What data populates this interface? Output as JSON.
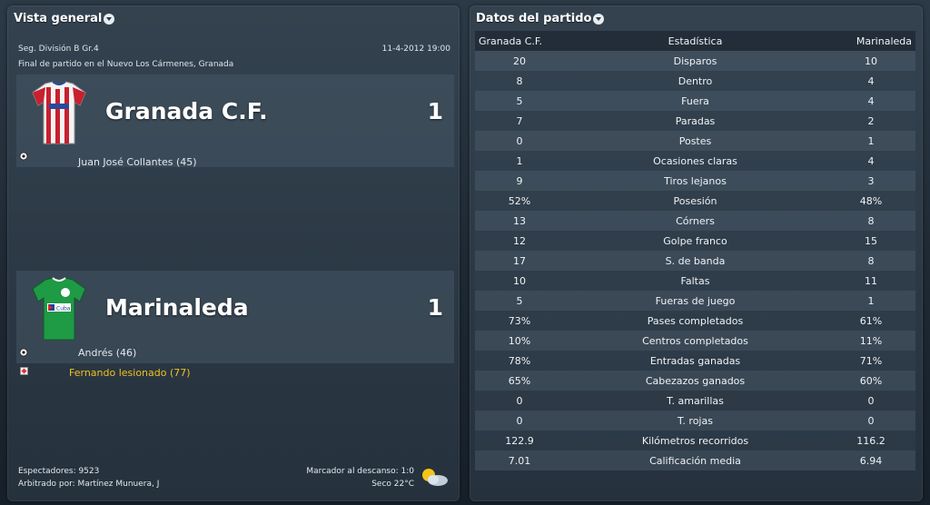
{
  "overview": {
    "title": "Vista general",
    "competition": "Seg. División B Gr.4",
    "datetime": "11-4-2012 19:00",
    "venue": "Final de partido en el Nuevo Los Cármenes, Granada",
    "home": {
      "name": "Granada C.F.",
      "score": "1",
      "goal_event": "Juan José Collantes (45)"
    },
    "away": {
      "name": "Marinaleda",
      "score": "1",
      "goal_event": "Andrés (46)",
      "injury_event": "Fernando lesionado (77)"
    },
    "attendance": "Espectadores: 9523",
    "referee": "Arbitrado por: Martínez Munuera, J",
    "halftime": "Marcador al descanso: 1:0",
    "weather": "Seco 22°C",
    "weather_icon": "sun-cloud-icon",
    "injury_color": "#f2c01e"
  },
  "match_stats": {
    "title": "Datos del partido",
    "headers": {
      "home": "Granada C.F.",
      "stat": "Estadística",
      "away": "Marinaleda"
    },
    "rows": [
      {
        "home": "20",
        "stat": "Disparos",
        "away": "10"
      },
      {
        "home": "8",
        "stat": "Dentro",
        "away": "4"
      },
      {
        "home": "5",
        "stat": "Fuera",
        "away": "4"
      },
      {
        "home": "7",
        "stat": "Paradas",
        "away": "2"
      },
      {
        "home": "0",
        "stat": "Postes",
        "away": "1"
      },
      {
        "home": "1",
        "stat": "Ocasiones claras",
        "away": "4"
      },
      {
        "home": "9",
        "stat": "Tiros lejanos",
        "away": "3"
      },
      {
        "home": "52%",
        "stat": "Posesión",
        "away": "48%"
      },
      {
        "home": "13",
        "stat": "Córners",
        "away": "8"
      },
      {
        "home": "12",
        "stat": "Golpe franco",
        "away": "15"
      },
      {
        "home": "17",
        "stat": "S. de banda",
        "away": "8"
      },
      {
        "home": "10",
        "stat": "Faltas",
        "away": "11"
      },
      {
        "home": "5",
        "stat": "Fueras de juego",
        "away": "1"
      },
      {
        "home": "73%",
        "stat": "Pases completados",
        "away": "61%"
      },
      {
        "home": "10%",
        "stat": "Centros completados",
        "away": "11%"
      },
      {
        "home": "78%",
        "stat": "Entradas ganadas",
        "away": "71%"
      },
      {
        "home": "65%",
        "stat": "Cabezazos ganados",
        "away": "60%"
      },
      {
        "home": "0",
        "stat": "T. amarillas",
        "away": "0"
      },
      {
        "home": "0",
        "stat": "T. rojas",
        "away": "0"
      },
      {
        "home": "122.9",
        "stat": "Kilómetros recorridos",
        "away": "116.2"
      },
      {
        "home": "7.01",
        "stat": "Calificación media",
        "away": "6.94"
      }
    ]
  }
}
